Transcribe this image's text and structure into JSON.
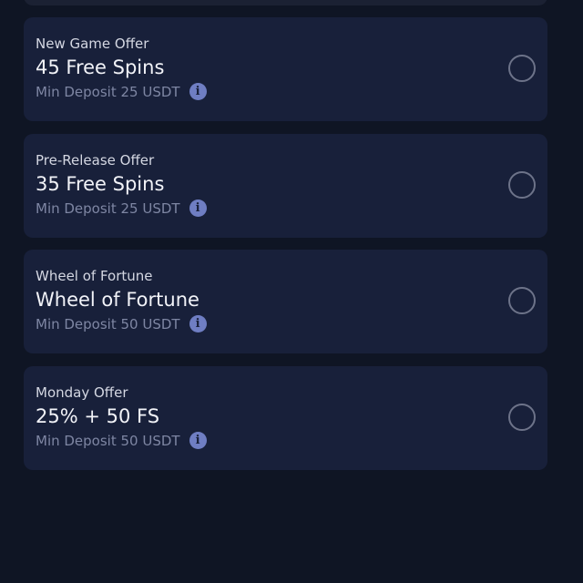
{
  "offers": [
    {
      "type": "New Game Offer",
      "title": "45 Free Spins",
      "deposit": "Min Deposit 25 USDT",
      "info_icon": "i"
    },
    {
      "type": "Pre-Release Offer",
      "title": "35 Free Spins",
      "deposit": "Min Deposit 25 USDT",
      "info_icon": "i"
    },
    {
      "type": "Wheel of Fortune",
      "title": "Wheel of Fortune",
      "deposit": "Min Deposit 50 USDT",
      "info_icon": "i"
    },
    {
      "type": "Monday Offer",
      "title": "25% + 50 FS",
      "deposit": "Min Deposit 50 USDT",
      "info_icon": "i"
    }
  ],
  "colors": {
    "background": "#0f1524",
    "card": "#18203a",
    "info_icon": "#6f7ec3",
    "radio_border": "#6d7389"
  }
}
